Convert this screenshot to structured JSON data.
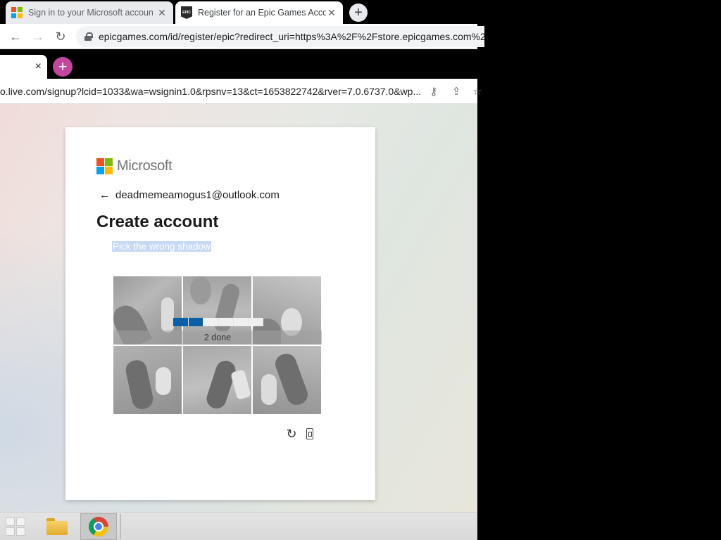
{
  "outer_browser": {
    "tabs": [
      {
        "title": "Sign in to your Microsoft accoun",
        "icon": "microsoft-favicon",
        "active": false
      },
      {
        "title": "Register for an Epic Games Acco",
        "icon": "epic-games-favicon",
        "active": true
      }
    ],
    "url": "epicgames.com/id/register/epic?redirect_uri=https%3A%2F%2Fstore.epicgames.com%2",
    "new_tab_label": "+"
  },
  "inner_browser": {
    "tab_close": "×",
    "new_tab_label": "+",
    "url": "o.live.com/signup?lcid=1033&wa=wsignin1.0&rpsnv=13&ct=1653822742&rver=7.0.6737.0&wp..."
  },
  "signup": {
    "brand": "Microsoft",
    "email": "deadmemeamogus1@outlook.com",
    "title": "Create account",
    "captcha_instruction": "Pick the wrong shadow",
    "progress_label": "2 done",
    "progress": {
      "done": 2,
      "total": 6
    }
  },
  "colors": {
    "ms_red": "#f25022",
    "ms_green": "#7fba00",
    "ms_blue": "#00a4ef",
    "ms_yellow": "#ffb900",
    "progress_fill": "#0b5fa6",
    "new_tab_pink": "#c2459e"
  },
  "taskbar": {
    "items": [
      "start-button",
      "file-explorer",
      "google-chrome"
    ]
  }
}
